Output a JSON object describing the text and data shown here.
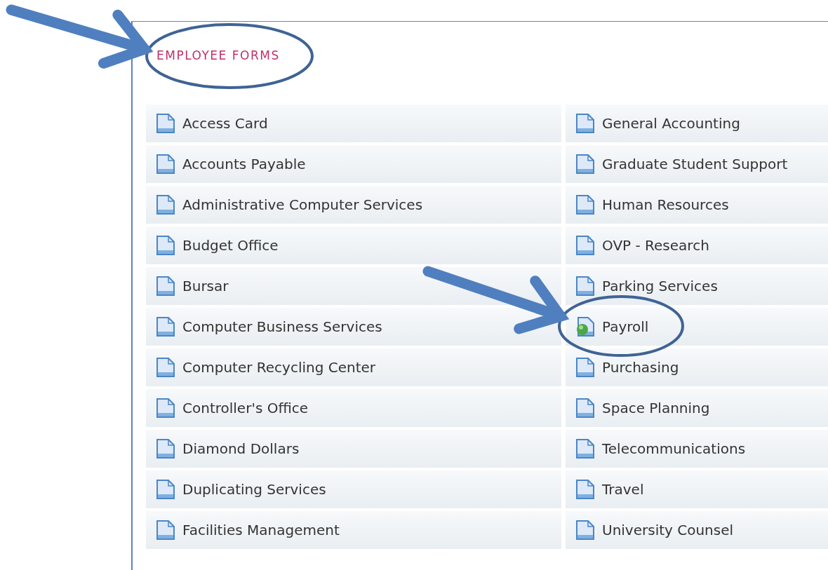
{
  "section": {
    "title": "EMPLOYEE FORMS",
    "circled": true
  },
  "columns": [
    [
      {
        "label": "Access Card",
        "kind": "document",
        "circled": false
      },
      {
        "label": "Accounts Payable",
        "kind": "document",
        "circled": false
      },
      {
        "label": "Administrative Computer Services",
        "kind": "document",
        "circled": false
      },
      {
        "label": "Budget Office",
        "kind": "document",
        "circled": false
      },
      {
        "label": "Bursar",
        "kind": "document",
        "circled": false
      },
      {
        "label": "Computer Business Services",
        "kind": "document",
        "circled": false
      },
      {
        "label": "Computer Recycling Center",
        "kind": "document",
        "circled": false
      },
      {
        "label": "Controller's Office",
        "kind": "document",
        "circled": false
      },
      {
        "label": "Diamond Dollars",
        "kind": "document",
        "circled": false
      },
      {
        "label": "Duplicating Services",
        "kind": "document",
        "circled": false
      },
      {
        "label": "Facilities Management",
        "kind": "document",
        "circled": false
      }
    ],
    [
      {
        "label": "General Accounting",
        "kind": "document",
        "circled": false
      },
      {
        "label": "Graduate Student Support",
        "kind": "document",
        "circled": false
      },
      {
        "label": "Human Resources",
        "kind": "document",
        "circled": false
      },
      {
        "label": "OVP - Research",
        "kind": "document",
        "circled": false
      },
      {
        "label": "Parking Services",
        "kind": "document",
        "circled": false
      },
      {
        "label": "Payroll",
        "kind": "web",
        "circled": true
      },
      {
        "label": "Purchasing",
        "kind": "document",
        "circled": false
      },
      {
        "label": "Space Planning",
        "kind": "document",
        "circled": false
      },
      {
        "label": "Telecommunications",
        "kind": "document",
        "circled": false
      },
      {
        "label": "Travel",
        "kind": "document",
        "circled": false
      },
      {
        "label": "University Counsel",
        "kind": "document",
        "circled": false
      }
    ]
  ]
}
